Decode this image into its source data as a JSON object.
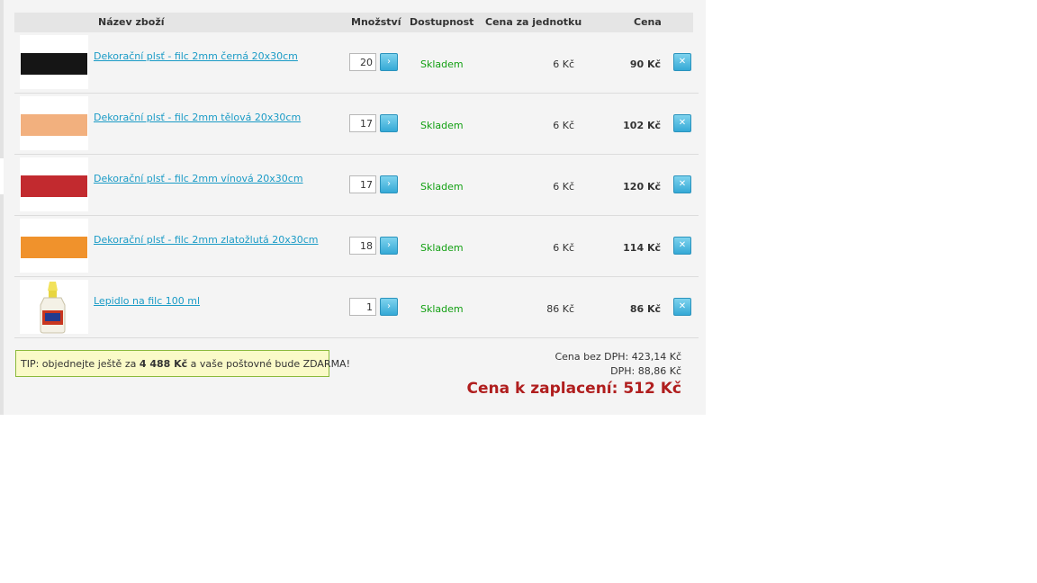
{
  "header": {
    "name": "Název zboží",
    "quantity": "Množství",
    "availability": "Dostupnost",
    "unit_price": "Cena za jednotku",
    "price": "Cena"
  },
  "update_icon": "›",
  "remove_icon": "✕",
  "items": [
    {
      "name": "Dekorační plsť - filc 2mm černá 20x30cm",
      "quantity": "20",
      "availability": "Skladem",
      "unit_price": "6 Kč",
      "price": "90 Kč",
      "color": "#151515"
    },
    {
      "name": "Dekorační plsť - filc 2mm tělová 20x30cm",
      "quantity": "17",
      "availability": "Skladem",
      "unit_price": "6 Kč",
      "price": "102 Kč",
      "color": "#f2b07e"
    },
    {
      "name": "Dekorační plsť - filc 2mm vínová 20x30cm",
      "quantity": "17",
      "availability": "Skladem",
      "unit_price": "6 Kč",
      "price": "120 Kč",
      "color": "#c22a2f"
    },
    {
      "name": "Dekorační plsť - filc 2mm zlatožlutá 20x30cm",
      "quantity": "18",
      "availability": "Skladem",
      "unit_price": "6 Kč",
      "price": "114 Kč",
      "color": "#f0922c"
    },
    {
      "name": "Lepidlo na filc 100 ml",
      "quantity": "1",
      "availability": "Skladem",
      "unit_price": "86 Kč",
      "price": "86 Kč",
      "color": ""
    }
  ],
  "tip": {
    "prefix": "TIP: objednejte ještě za ",
    "amount": "4 488 Kč",
    "suffix": " a vaše poštovné bude ZDARMA!"
  },
  "summary": {
    "without_vat": "Cena bez DPH: 423,14 Kč",
    "vat": "DPH: 88,86 Kč",
    "total": "Cena k zaplacení: 512 Kč"
  }
}
